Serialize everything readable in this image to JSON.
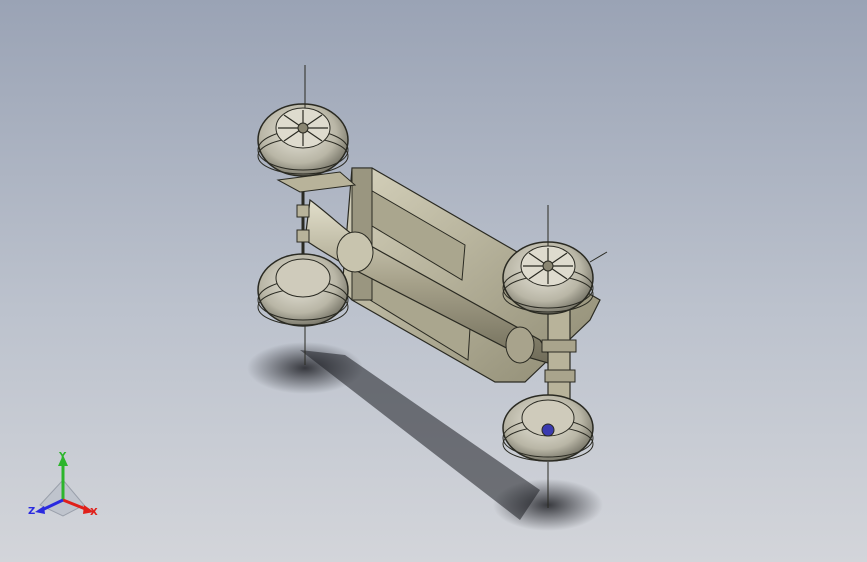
{
  "viewport": {
    "background_top": "#9aa3b5",
    "background_bottom": "#d3d5da",
    "model_color": "#b8b39a",
    "outline_color": "#2a2a22"
  },
  "triad": {
    "x_label": "X",
    "y_label": "Y",
    "z_label": "Z",
    "x_color": "#e0201a",
    "y_color": "#2cb52c",
    "z_color": "#2a2ae0"
  }
}
